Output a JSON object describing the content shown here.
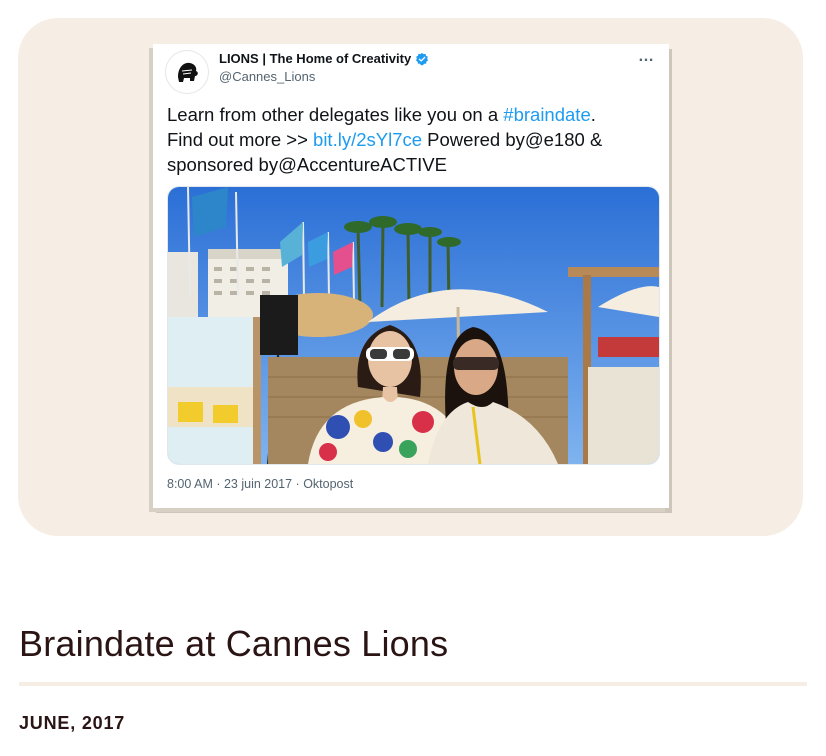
{
  "tweet": {
    "account_name": "LIONS | The Home of Creativity",
    "handle": "@Cannes_Lions",
    "more_icon": "…",
    "text_parts": {
      "p1": "Learn from other delegates like you on a ",
      "hashtag": "#braindate",
      "p2": ".",
      "p3": "Find out more >> ",
      "link": "bit.ly/2sYl7ce",
      "p4": " Powered by@e180 &",
      "p5": "sponsored by@AccentureACTIVE"
    },
    "timestamp": "8:00 AM · 23 juin 2017 · Oktopost",
    "link_color": "#1d9bf0",
    "verified_color": "#1d9bf0"
  },
  "article": {
    "title": "Braindate at Cannes Lions",
    "date": "JUNE, 2017"
  },
  "colors": {
    "card_background": "#f6eee5",
    "title_text": "#2a1414"
  }
}
